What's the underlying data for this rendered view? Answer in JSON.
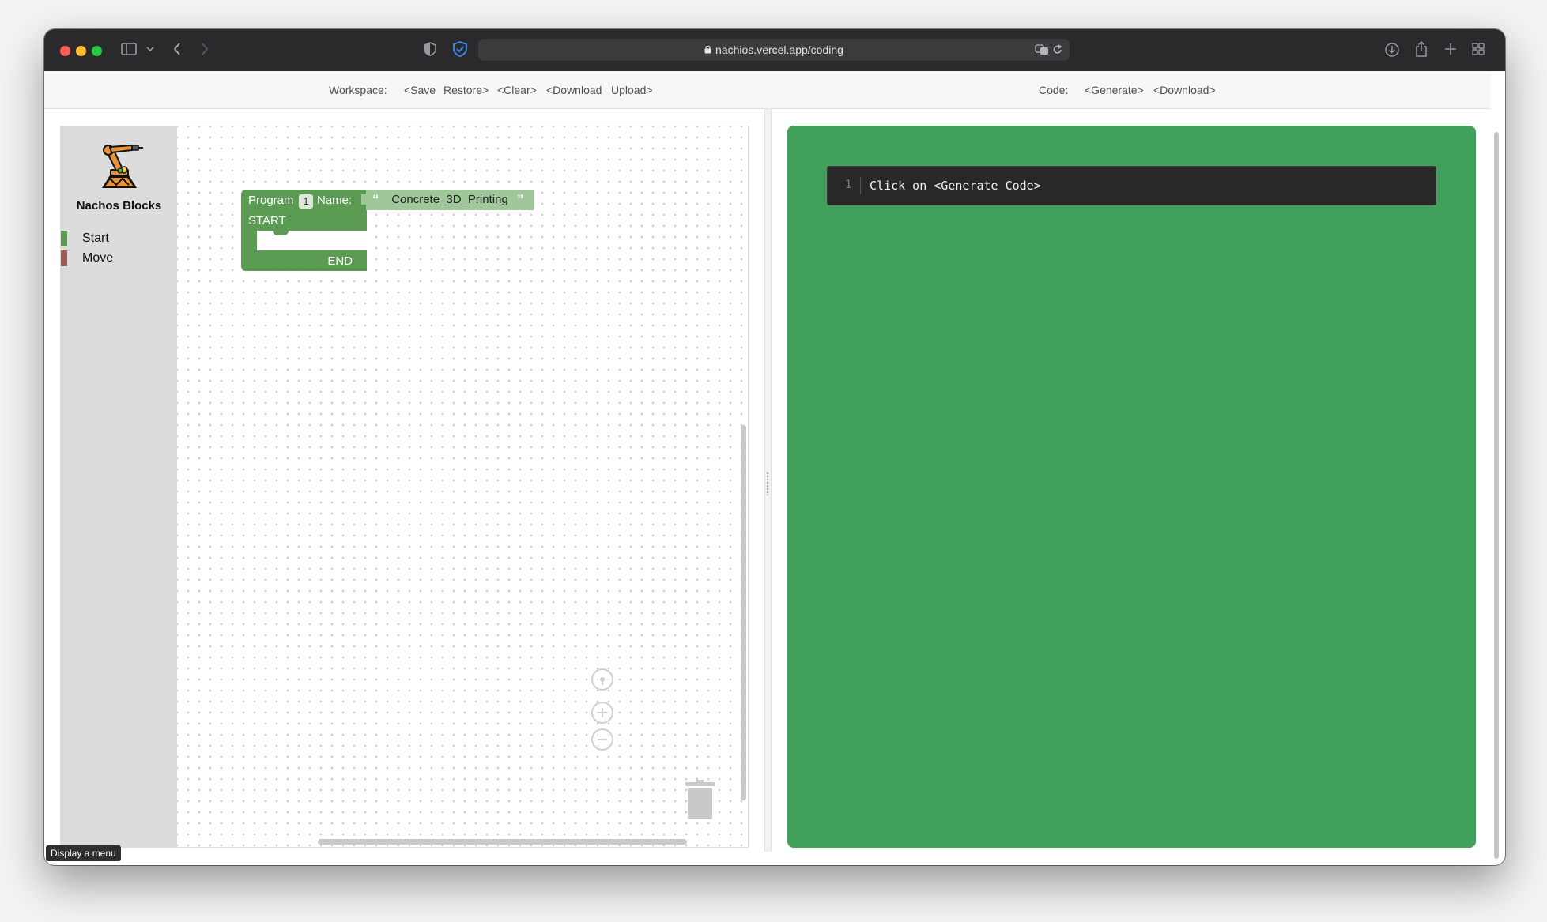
{
  "browser": {
    "url": "nachios.vercel.app/coding"
  },
  "toolbar": {
    "workspace_label": "Workspace:",
    "save_label": "<Save",
    "restore_label": "Restore>",
    "clear_label": "<Clear>",
    "download_label": "<Download",
    "upload_label": "Upload>",
    "code_label": "Code:",
    "generate_label": "<Generate>",
    "code_download_label": "<Download>"
  },
  "toolbox": {
    "brand": "Nachos Blocks",
    "categories": [
      {
        "label": "Start",
        "color": "#5b9b53"
      },
      {
        "label": "Move",
        "color": "#9b5b5b"
      }
    ]
  },
  "workspace": {
    "program_block": {
      "program_label": "Program",
      "program_number": "1",
      "name_label": "Name:",
      "name_value": "Concrete_3D_Printing",
      "start_label": "START",
      "end_label": "END",
      "color": "#5b9b53"
    }
  },
  "code": {
    "line_number": "1",
    "line_text": "Click on <Generate Code>",
    "panel_color": "#41a15c"
  },
  "tooltip": {
    "text": "Display a menu"
  }
}
